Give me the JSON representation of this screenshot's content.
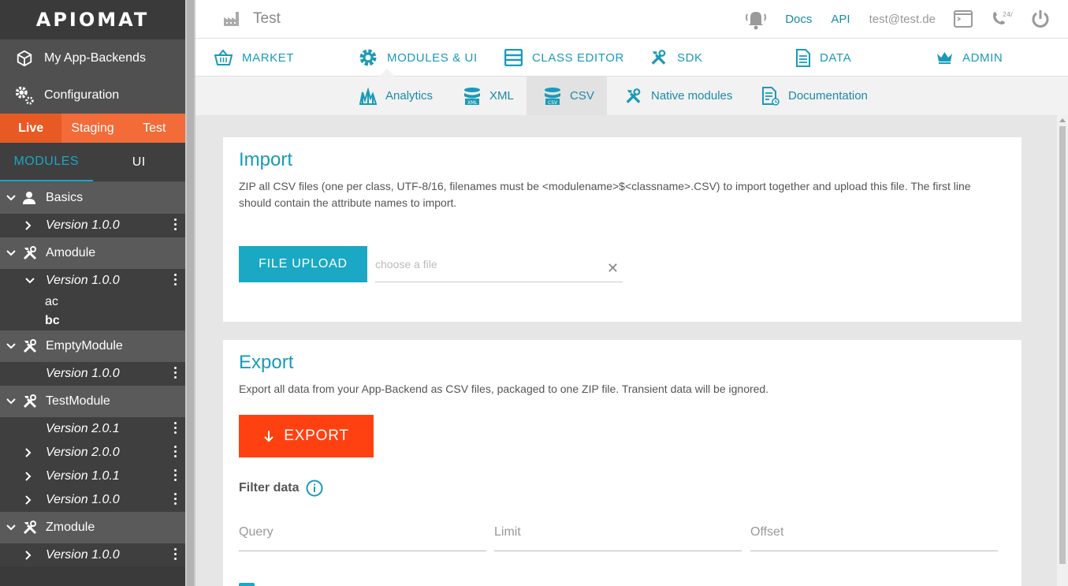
{
  "sidebar": {
    "logo": "APIOMAT",
    "nav": [
      {
        "label": "My App-Backends",
        "icon": "cube-icon"
      },
      {
        "label": "Configuration",
        "icon": "gears-icon"
      }
    ],
    "env_tabs": [
      "Live",
      "Staging",
      "Test"
    ],
    "active_env": "Live",
    "mode_tabs": [
      "MODULES",
      "UI"
    ],
    "active_mode": "MODULES",
    "modules": [
      {
        "name": "Basics",
        "icon": "user-icon",
        "versions": [
          {
            "label": "Version 1.0.0",
            "chevron": "right"
          }
        ]
      },
      {
        "name": "Amodule",
        "icon": "tools-icon",
        "versions": [
          {
            "label": "Version 1.0.0",
            "chevron": "down",
            "classes": [
              "ac",
              "bc"
            ]
          }
        ]
      },
      {
        "name": "EmptyModule",
        "icon": "tools-icon",
        "versions": [
          {
            "label": "Version 1.0.0",
            "chevron": "none"
          }
        ]
      },
      {
        "name": "TestModule",
        "icon": "tools-icon",
        "versions": [
          {
            "label": "Version 2.0.1",
            "chevron": "none"
          },
          {
            "label": "Version 2.0.0",
            "chevron": "right"
          },
          {
            "label": "Version 1.0.1",
            "chevron": "right"
          },
          {
            "label": "Version 1.0.0",
            "chevron": "right"
          }
        ]
      },
      {
        "name": "Zmodule",
        "icon": "tools-icon",
        "versions": [
          {
            "label": "Version 1.0.0",
            "chevron": "right"
          }
        ]
      }
    ]
  },
  "topbar": {
    "app_name": "Test",
    "docs": "Docs",
    "api": "API",
    "email": "test@test.de",
    "support_badge": "24/7"
  },
  "mainnav": [
    {
      "label": "MARKET",
      "icon": "basket-icon"
    },
    {
      "label": "MODULES & UI",
      "icon": "gear-icon"
    },
    {
      "label": "CLASS EDITOR",
      "icon": "class-editor-icon"
    },
    {
      "label": "SDK",
      "icon": "tools-icon"
    },
    {
      "label": "DATA",
      "icon": "document-icon"
    },
    {
      "label": "ADMIN",
      "icon": "crown-icon"
    }
  ],
  "subnav": [
    {
      "label": "Analytics",
      "icon": "analytics-icon"
    },
    {
      "label": "XML",
      "icon": "xml-icon"
    },
    {
      "label": "CSV",
      "icon": "csv-icon"
    },
    {
      "label": "Native modules",
      "icon": "tools-icon"
    },
    {
      "label": "Documentation",
      "icon": "documentation-icon"
    }
  ],
  "active_subnav": "CSV",
  "import": {
    "title": "Import",
    "description": "ZIP all CSV files (one per class, UTF-8/16, filenames must be <modulename>$<classname>.CSV) to import together and upload this file. The first line should contain the attribute names to import.",
    "upload_label": "FILE UPLOAD",
    "file_placeholder": "choose a file",
    "clear_symbol": "✕"
  },
  "export": {
    "title": "Export",
    "description": "Export all data from your App-Backend as CSV files, packaged to one ZIP file. Transient data will be ignored.",
    "button_label": "EXPORT",
    "filter_label": "Filter data",
    "query_placeholder": "Query",
    "limit_placeholder": "Limit",
    "offset_placeholder": "Offset"
  },
  "colors": {
    "accent": "#1aa8c4",
    "env_bar": "#f26b38",
    "export_button": "#ff4111",
    "sidebar_dark": "#3f3f3f",
    "sidebar_module": "#5a5a5a"
  }
}
